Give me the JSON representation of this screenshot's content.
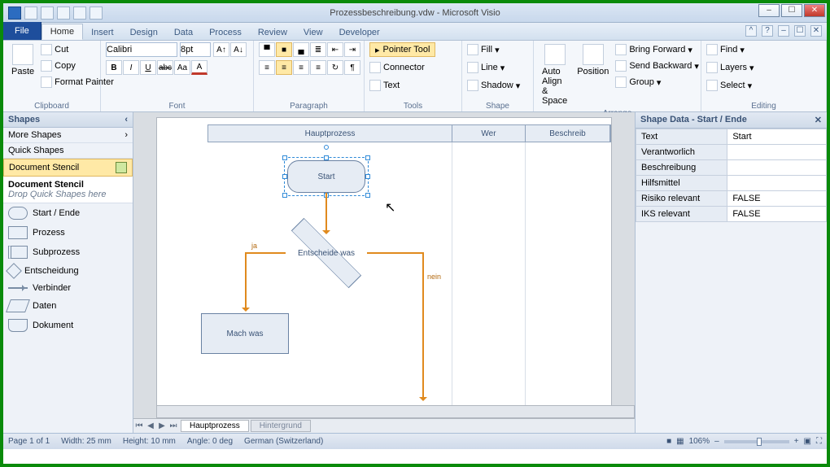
{
  "app": {
    "title": "Prozessbeschreibung.vdw - Microsoft Visio"
  },
  "tabs": {
    "file": "File",
    "items": [
      "Home",
      "Insert",
      "Design",
      "Data",
      "Process",
      "Review",
      "View",
      "Developer"
    ],
    "active": "Home"
  },
  "ribbon": {
    "clipboard": {
      "label": "Clipboard",
      "paste": "Paste",
      "cut": "Cut",
      "copy": "Copy",
      "format_painter": "Format Painter"
    },
    "font": {
      "label": "Font",
      "family": "Calibri",
      "size": "8pt",
      "bold": "B",
      "italic": "I",
      "underline": "U",
      "strike": "abc",
      "grow": "A▲",
      "shrink": "A▼"
    },
    "paragraph": {
      "label": "Paragraph"
    },
    "tools": {
      "label": "Tools",
      "pointer": "Pointer Tool",
      "connector": "Connector",
      "text": "Text"
    },
    "shape": {
      "label": "Shape",
      "fill": "Fill",
      "line": "Line",
      "shadow": "Shadow"
    },
    "arrange": {
      "label": "Arrange",
      "autoalign": "Auto Align & Space",
      "position": "Position",
      "bring_forward": "Bring Forward",
      "send_backward": "Send Backward",
      "group": "Group"
    },
    "editing": {
      "label": "Editing",
      "find": "Find",
      "layers": "Layers",
      "select": "Select"
    }
  },
  "shapes_pane": {
    "title": "Shapes",
    "more": "More Shapes",
    "quick": "Quick Shapes",
    "doc_stencil": "Document Stencil",
    "stencil_title": "Document Stencil",
    "stencil_hint": "Drop Quick Shapes here",
    "items": [
      "Start / Ende",
      "Prozess",
      "Subprozess",
      "Entscheidung",
      "Verbinder",
      "Daten",
      "Dokument"
    ]
  },
  "canvas": {
    "lanes": [
      "Hauptprozess",
      "Wer",
      "Beschreib"
    ],
    "start": "Start",
    "decision": "Entscheide was",
    "process": "Mach was",
    "yes": "ja",
    "no": "nein",
    "sheets": {
      "active": "Hauptprozess",
      "inactive": "Hintergrund"
    }
  },
  "shape_data": {
    "title": "Shape Data - Start / Ende",
    "rows": [
      {
        "k": "Text",
        "v": "Start"
      },
      {
        "k": "Verantworlich",
        "v": ""
      },
      {
        "k": "Beschreibung",
        "v": ""
      },
      {
        "k": "Hilfsmittel",
        "v": ""
      },
      {
        "k": "Risiko relevant",
        "v": "FALSE"
      },
      {
        "k": "IKS relevant",
        "v": "FALSE"
      }
    ]
  },
  "status": {
    "page": "Page 1 of 1",
    "width": "Width: 25 mm",
    "height": "Height: 10 mm",
    "angle": "Angle: 0 deg",
    "lang": "German (Switzerland)",
    "zoom": "106%"
  }
}
